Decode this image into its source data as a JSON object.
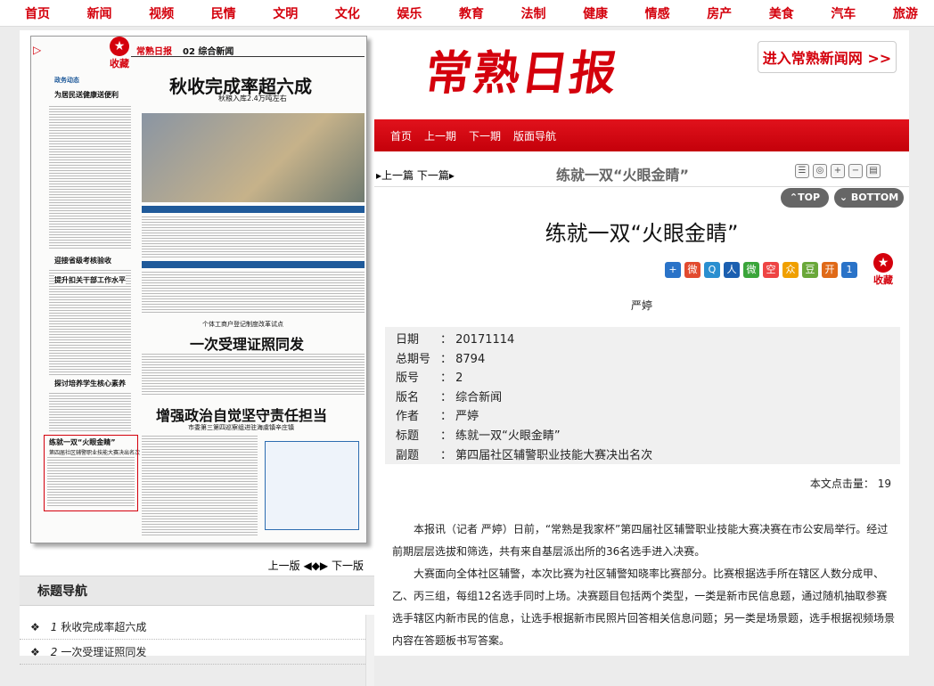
{
  "topnav": [
    "首页",
    "新闻",
    "视频",
    "民情",
    "文明",
    "文化",
    "娱乐",
    "教育",
    "法制",
    "健康",
    "情感",
    "房产",
    "美食",
    "汽车",
    "旅游"
  ],
  "newspaper": {
    "favorite_label": "收藏",
    "masthead": "常熟日报",
    "page_label": "02 综合新闻",
    "headline1": "秋收完成率超六成",
    "subhead1": "秋粮入库2.4万吨左右",
    "col_head1": "政务动态",
    "col_head2": "为居民送健康送便利",
    "col_head3": "迎接省级考核验收",
    "col_head4": "提升扣关干部工作水平",
    "col_head5": "探讨培养学生核心素养",
    "headline2": "一次受理证照同发",
    "pre_headline2": "个体工商户登记制度改革试点",
    "headline3": "增强政治自觉坚守责任担当",
    "sub_headline3": "市委第三第四巡察组进驻海虞镇辛庄镇",
    "highlight_title": "练就一双“火眼金睛”",
    "highlight_sub": "第四届社区辅警职业技能大赛决出名次"
  },
  "pagenav": {
    "prev": "上一版",
    "next": "下一版"
  },
  "title_nav": {
    "heading": "标题导航",
    "items": [
      {
        "num": "1",
        "title": "秋收完成率超六成"
      },
      {
        "num": "2",
        "title": "一次受理证照同发"
      }
    ]
  },
  "brand": {
    "logo": "常熟日报",
    "enter": "进入常熟新闻网 >>"
  },
  "redbar": [
    "首页",
    "上一期",
    "下一期",
    "版面导航"
  ],
  "article_header": {
    "prev": "上一篇",
    "next": "下一篇",
    "title": "练就一双“火眼金睛”"
  },
  "top_btn": "TOP",
  "bottom_btn": "BOTTOM",
  "article": {
    "title": "练就一双“火眼金睛”",
    "favorite_label": "收藏",
    "author": "严婷",
    "meta": [
      {
        "k": "日期",
        "v": "20171114"
      },
      {
        "k": "总期号",
        "v": "8794"
      },
      {
        "k": "版号",
        "v": "2"
      },
      {
        "k": "版名",
        "v": "综合新闻"
      },
      {
        "k": "作者",
        "v": "严婷"
      },
      {
        "k": "标题",
        "v": "练就一双“火眼金睛”"
      },
      {
        "k": "副题",
        "v": "第四届社区辅警职业技能大赛决出名次"
      }
    ],
    "hits_label": "本文点击量：",
    "hits_value": "19",
    "paragraphs": [
      "本报讯（记者 严婷）日前，“常熟是我家杯”第四届社区辅警职业技能大赛决赛在市公安局举行。经过前期层层选拔和筛选，共有来自基层派出所的36名选手进入决赛。",
      "大赛面向全体社区辅警，本次比赛为社区辅警知晓率比赛部分。比赛根据选手所在辖区人数分成甲、乙、丙三组，每组12名选手同时上场。决赛题目包括两个类型，一类是新市民信息题，通过随机抽取参赛选手辖区内新市民的信息，让选手根据新市民照片回答相关信息问题；另一类是场景题，选手根据视频场景内容在答题板书写答案。"
    ]
  },
  "share_icons": [
    "+",
    "微",
    "Q",
    "人",
    "微",
    "空",
    "众",
    "豆",
    "开",
    "1"
  ],
  "share_colors": [
    "#2a73c8",
    "#e24a2f",
    "#2a8fd0",
    "#1b5fb0",
    "#3aa53a",
    "#e44",
    "#f0a000",
    "#6aa83a",
    "#e06a18",
    "#2a73c8"
  ]
}
